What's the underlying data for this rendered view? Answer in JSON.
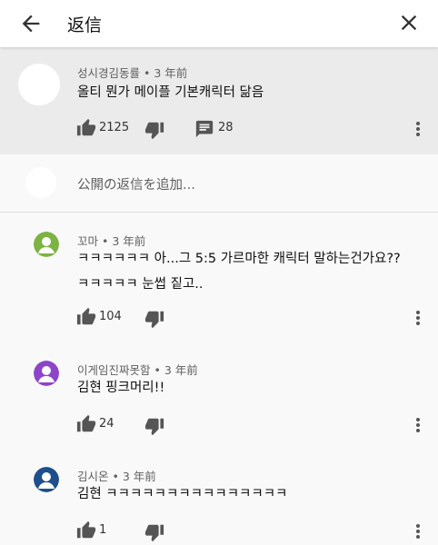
{
  "header": {
    "title": "返信",
    "back_icon": "arrow-left-icon",
    "close_icon": "close-icon"
  },
  "top_comment": {
    "author": "성시경김동률",
    "time": "3 年前",
    "meta_sep": " • ",
    "text": "올티 뭔가 메이플 기본캐릭터 닮음",
    "likes": "2125",
    "replies": "28"
  },
  "add_reply": {
    "placeholder": "公開の返信を追加..."
  },
  "replies": [
    {
      "author": "꼬마",
      "time": "3 年前",
      "lines": [
        "ㅋㅋㅋㅋㅋㅋ 아...그 5:5 가르마한 캐릭터 말하는건가요??",
        "ㅋㅋㅋㅋㅋ 눈썹 짙고.."
      ],
      "likes": "104",
      "avatar_color": "#7cb342"
    },
    {
      "author": "이게임진짜못함",
      "time": "3 年前",
      "lines": [
        "김현 핑크머리!!"
      ],
      "likes": "24",
      "avatar_color": "#8e44c8"
    },
    {
      "author": "김시온",
      "time": "3 年前",
      "lines": [
        "김현 ㅋㅋㅋㅋㅋㅋㅋㅋㅋㅋㅋㅋㅋㅋㅋ"
      ],
      "likes": "1",
      "avatar_color": "#1e4f8c"
    }
  ]
}
